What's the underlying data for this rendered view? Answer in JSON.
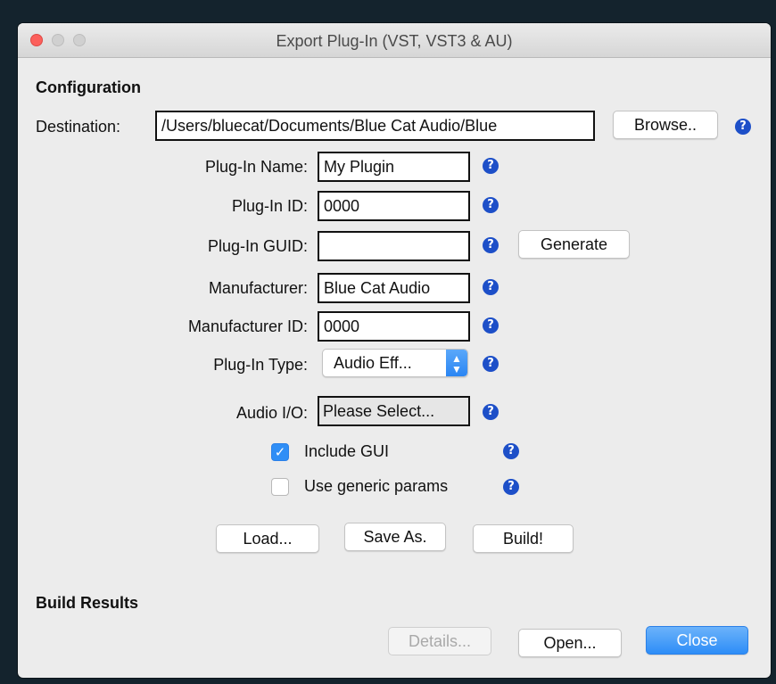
{
  "window": {
    "title": "Export Plug-In (VST, VST3 & AU)"
  },
  "config": {
    "heading": "Configuration",
    "destination_label": "Destination:",
    "destination_value": "/Users/bluecat/Documents/Blue Cat Audio/Blue",
    "browse_label": "Browse..",
    "plugin_name_label": "Plug-In Name:",
    "plugin_name_value": "My Plugin",
    "plugin_id_label": "Plug-In ID:",
    "plugin_id_value": "0000",
    "plugin_guid_label": "Plug-In GUID:",
    "plugin_guid_value": "",
    "generate_label": "Generate",
    "manufacturer_label": "Manufacturer:",
    "manufacturer_value": "Blue Cat Audio",
    "manufacturer_id_label": "Manufacturer ID:",
    "manufacturer_id_value": "0000",
    "plugin_type_label": "Plug-In Type:",
    "plugin_type_value": "Audio Eff...",
    "audio_io_label": "Audio I/O:",
    "audio_io_value": "Please Select...",
    "include_gui_label": "Include GUI",
    "include_gui_checked": true,
    "generic_params_label": "Use generic params",
    "generic_params_checked": false,
    "help_glyph": "?"
  },
  "actions": {
    "load_label": "Load...",
    "save_as_label": "Save As.",
    "build_label": "Build!"
  },
  "results": {
    "heading": "Build Results",
    "details_label": "Details...",
    "open_label": "Open...",
    "close_label": "Close"
  },
  "icons": {
    "help": "question-circle-icon",
    "checkmark": "checkmark-icon",
    "select_arrows": "up-down-chevron-icon"
  },
  "colors": {
    "accent": "#2d8df7",
    "help_icon": "#1d4fc8",
    "close_traffic": "#fc605c"
  }
}
